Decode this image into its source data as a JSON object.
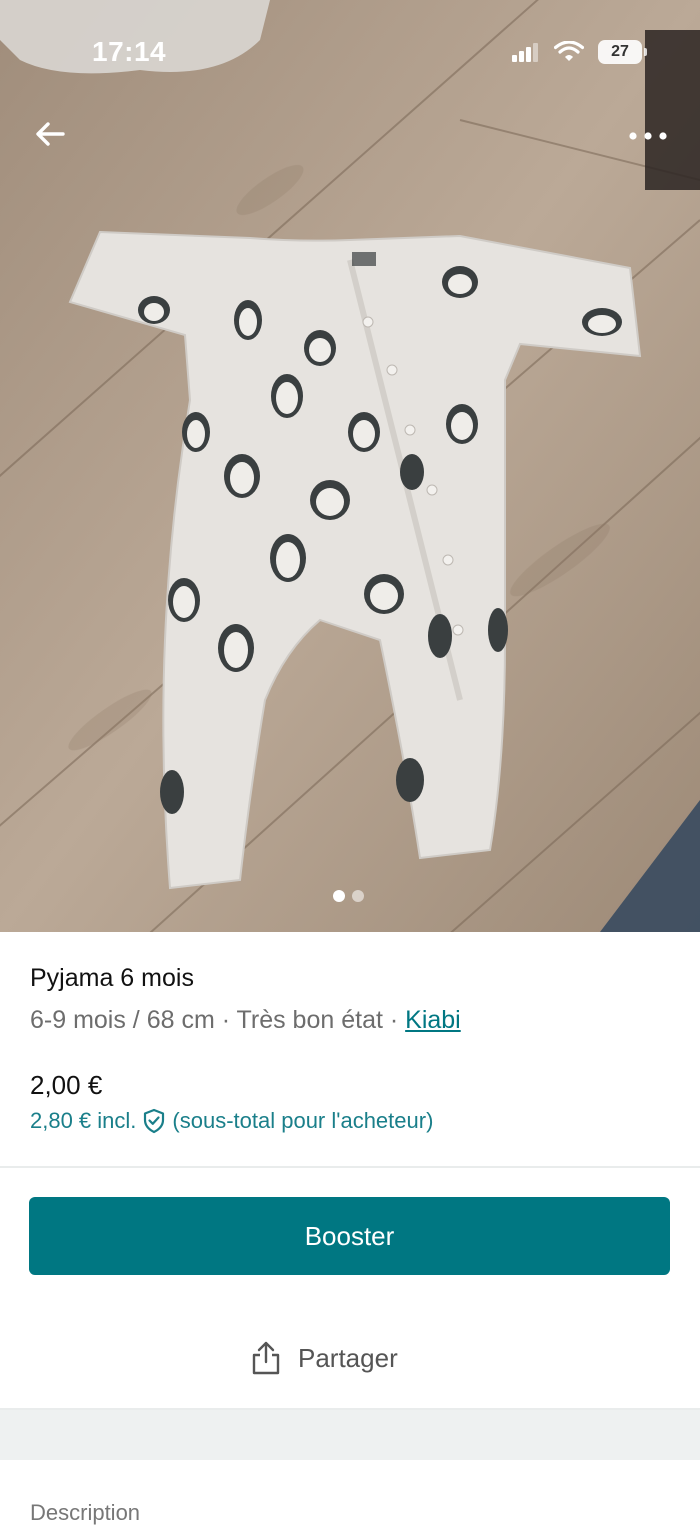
{
  "status_bar": {
    "time": "17:14",
    "battery": "27"
  },
  "gallery": {
    "page_count": 2,
    "active_page": 1
  },
  "item": {
    "title": "Pyjama 6 mois",
    "meta_prefix": "6-9 mois / 68 cm · Très bon état · ",
    "brand": "Kiabi",
    "price": "2,00 €",
    "price_incl": "2,80 € incl.",
    "price_incl_note": "(sous-total pour l'acheteur)"
  },
  "actions": {
    "booster_label": "Booster",
    "share_label": "Partager"
  },
  "section": {
    "description_label": "Description"
  },
  "icons": {
    "back": "arrow-left-icon",
    "more": "more-horizontal-icon",
    "shield": "shield-check-icon",
    "share": "share-icon",
    "signal": "signal-icon",
    "wifi": "wifi-icon"
  },
  "colors": {
    "accent": "#007782",
    "accent_text": "#1a7f8a",
    "muted": "#6d6d6d"
  }
}
